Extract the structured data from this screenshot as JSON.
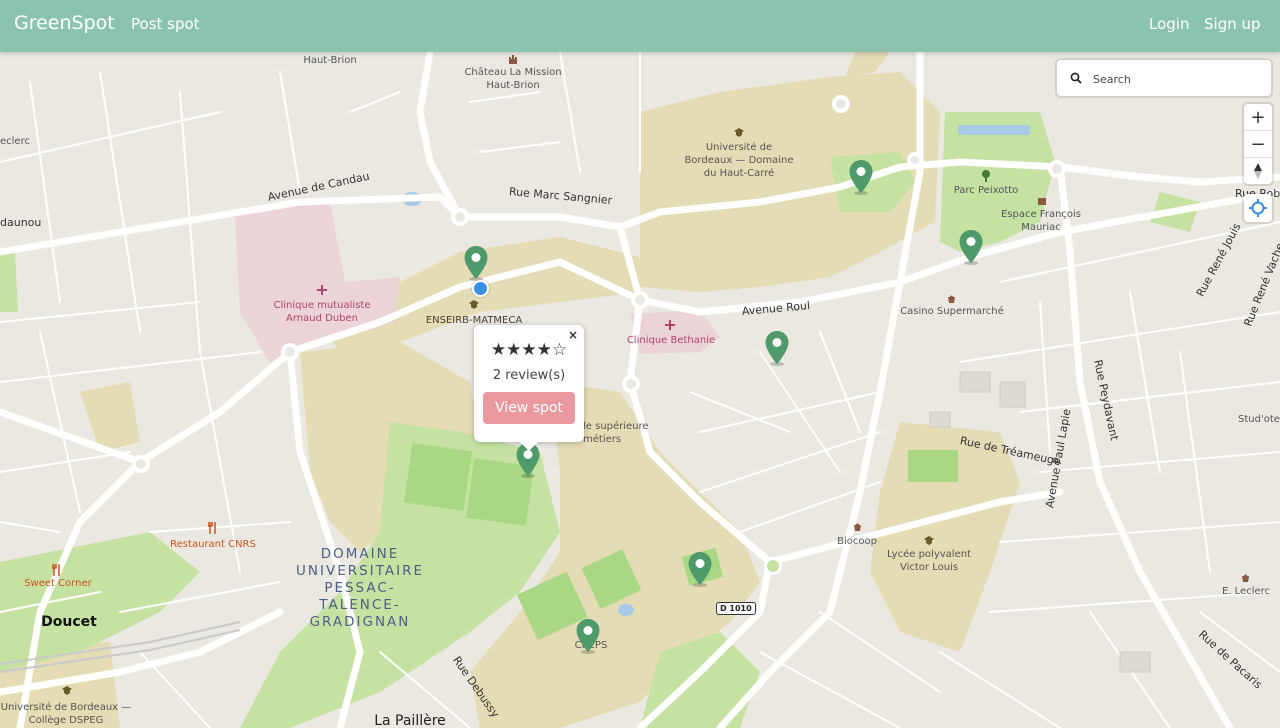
{
  "nav": {
    "brand": "GreenSpot",
    "post_spot": "Post spot",
    "login": "Login",
    "signup": "Sign up"
  },
  "search": {
    "placeholder": "Search"
  },
  "controls": {
    "zoom_in": "+",
    "zoom_out": "−"
  },
  "popup": {
    "stars": "★★★★☆",
    "rating": 4,
    "reviews": "2 review(s)",
    "button": "View spot",
    "close": "×"
  },
  "labels": {
    "haut_brion": "Haut-Brion",
    "chateau_1": "Château La Mission",
    "chateau_2": "Haut-Brion",
    "leclerc_left": "eclerc",
    "candau": "Avenue de Candau",
    "marc_sangnier": "Rue Marc Sangnier",
    "daunou": "daunou",
    "univ_1": "Université de",
    "univ_2": "Bordeaux — Domaine",
    "univ_3": "du Haut-Carré",
    "parc": "Parc Peixotto",
    "espace_1": "Espace François",
    "espace_2": "Mauriac",
    "rue_rob": "Rue Rob",
    "rene_jouis": "Rue René Jouis",
    "rene_vache": "Rue René Vache",
    "clinique_mut_1": "Clinique mutualiste",
    "clinique_mut_2": "Arnaud Duben",
    "enseirb": "ENSEIRB-MATMECA",
    "bethanie": "Clinique Bethanie",
    "avenue_roul": "Avenue Roul",
    "casino": "Casino Supermarché",
    "peydavant": "Rue Peydavant",
    "studotel": "Stud'otel",
    "ecole_1": "le supérieure",
    "ecole_2": "métiers",
    "tremeuge": "Rue de Tréameuge",
    "paul_lapie": "Avenue Paul Lapie",
    "biocoop": "Biocoop",
    "lycee_1": "Lycée polyvalent",
    "lycee_2": "Victor Louis",
    "cnrs": "Restaurant CNRS",
    "sweet": "Sweet Corner",
    "doucet": "Doucet",
    "domaine_1": "DOMAINE",
    "domaine_2": "UNIVERSITAIRE",
    "domaine_3": "PESSAC-",
    "domaine_4": "TALENCE-",
    "domaine_5": "GRADIGNAN",
    "d1010": "D 1010",
    "creps": "CREPS",
    "debussy": "Rue Debussy",
    "leclerc_right": "E. Leclerc",
    "pacaris": "Rue de Pacaris",
    "dspeg_1": "Université de Bordeaux —",
    "dspeg_2": "Collège DSPEG",
    "paillere": "La Paillère"
  }
}
